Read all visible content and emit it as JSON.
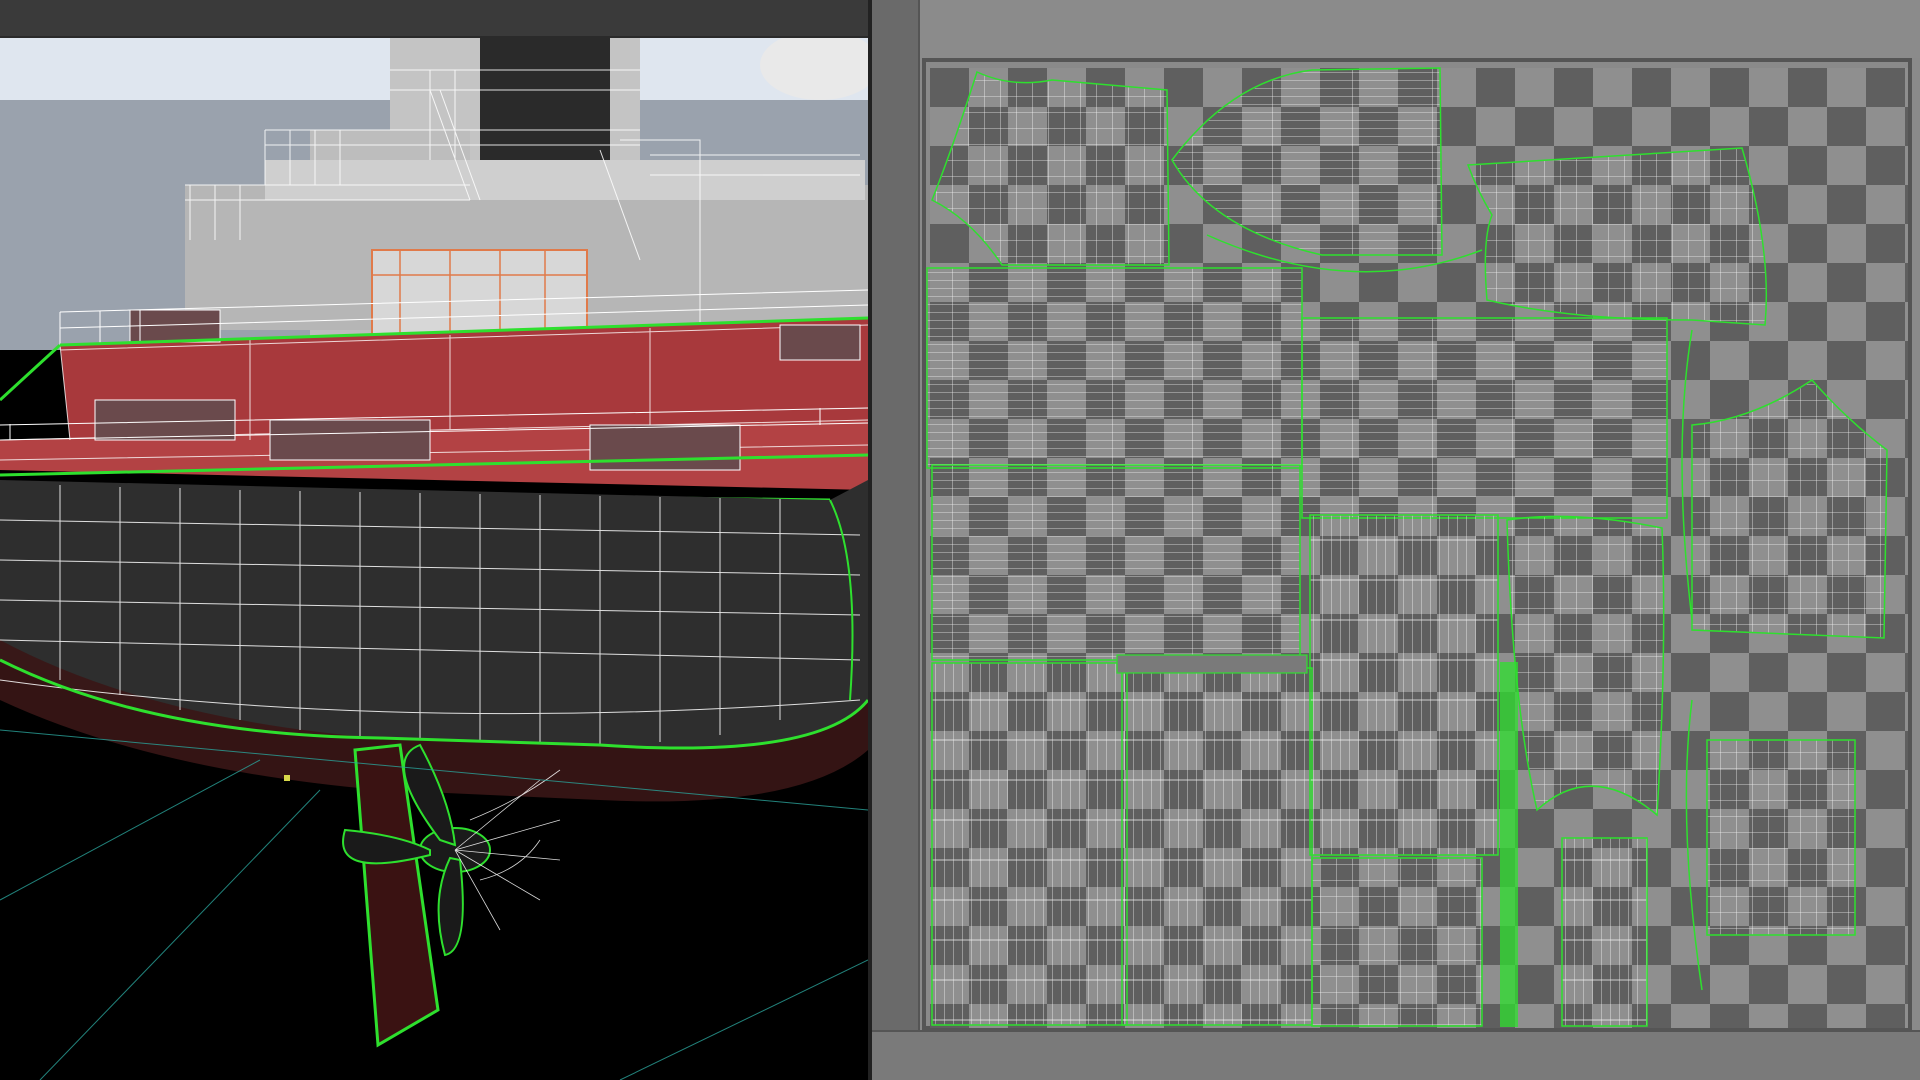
{
  "app": {
    "panels": [
      "perspective-viewport",
      "uv-editor"
    ]
  },
  "viewport": {
    "scene": "ship-stern-wireframe",
    "colors": {
      "background": "#000000",
      "sky": "#c9d3df",
      "superstructure": "#bdbdbd",
      "deck": "#a8393c",
      "hull": "#2b2b2b",
      "hull_lower": "#5a1f1f",
      "selection": "#2ee02e",
      "wire": "#ffffff",
      "grid": "#2aa39a"
    }
  },
  "uv_editor": {
    "texture": "checker",
    "colors": {
      "checker_light": "#8f8f8f",
      "checker_dark": "#5f5f5f",
      "background": "#8a8a8a",
      "island_outline": "#2ee02e",
      "island_mesh": "#ffffff"
    }
  }
}
